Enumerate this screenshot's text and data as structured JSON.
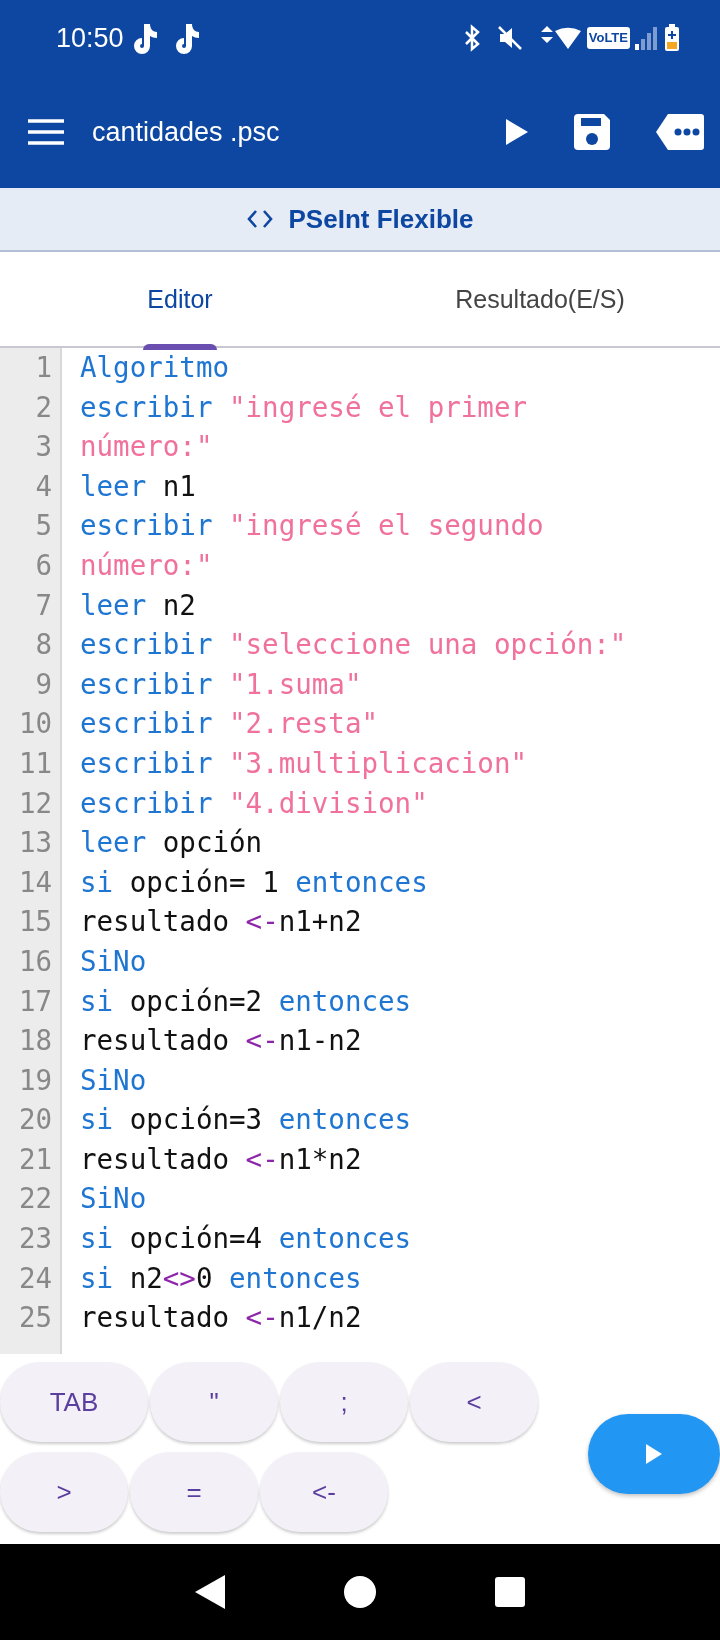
{
  "status_bar": {
    "time": "10:50",
    "volte": "VoLTE"
  },
  "toolbar": {
    "title": "cantidades .psc"
  },
  "mode_bar": {
    "label": "PSeInt Flexible"
  },
  "tabs": [
    {
      "label": "Editor",
      "selected": true
    },
    {
      "label": "Resultado(E/S)",
      "selected": false
    }
  ],
  "editor": {
    "lines": [
      {
        "number": "1",
        "tokens": [
          {
            "kind": "keyword",
            "text": "Algoritmo"
          }
        ]
      },
      {
        "number": "2",
        "tokens": [
          {
            "kind": "keyword",
            "text": "escribir"
          },
          {
            "kind": "string",
            "text": " \"ingresé el primer"
          }
        ]
      },
      {
        "number": "3",
        "tokens": [
          {
            "kind": "string",
            "text": "número:\""
          }
        ]
      },
      {
        "number": "4",
        "tokens": [
          {
            "kind": "keyword",
            "text": "leer"
          },
          {
            "kind": "plain",
            "text": " n1"
          }
        ]
      },
      {
        "number": "5",
        "tokens": [
          {
            "kind": "keyword",
            "text": "escribir"
          },
          {
            "kind": "string",
            "text": " \"ingresé el segundo"
          }
        ]
      },
      {
        "number": "6",
        "tokens": [
          {
            "kind": "string",
            "text": "número:\""
          }
        ]
      },
      {
        "number": "7",
        "tokens": [
          {
            "kind": "keyword",
            "text": "leer"
          },
          {
            "kind": "plain",
            "text": " n2"
          }
        ]
      },
      {
        "number": "8",
        "tokens": [
          {
            "kind": "keyword",
            "text": "escribir"
          },
          {
            "kind": "string",
            "text": " \"seleccione una opción:\""
          }
        ]
      },
      {
        "number": "9",
        "tokens": [
          {
            "kind": "keyword",
            "text": "escribir"
          },
          {
            "kind": "string",
            "text": " \"1.suma\""
          }
        ]
      },
      {
        "number": "10",
        "tokens": [
          {
            "kind": "keyword",
            "text": "escribir"
          },
          {
            "kind": "string",
            "text": " \"2.resta\""
          }
        ]
      },
      {
        "number": "11",
        "tokens": [
          {
            "kind": "keyword",
            "text": "escribir"
          },
          {
            "kind": "string",
            "text": " \"3.multiplicacion\""
          }
        ]
      },
      {
        "number": "12",
        "tokens": [
          {
            "kind": "keyword",
            "text": "escribir"
          },
          {
            "kind": "string",
            "text": " \"4.division\""
          }
        ]
      },
      {
        "number": "13",
        "tokens": [
          {
            "kind": "keyword",
            "text": "leer"
          },
          {
            "kind": "plain",
            "text": " opción"
          }
        ]
      },
      {
        "number": "14",
        "tokens": [
          {
            "kind": "keyword",
            "text": "si"
          },
          {
            "kind": "plain",
            "text": " opción= 1 "
          },
          {
            "kind": "keyword",
            "text": "entonces"
          }
        ]
      },
      {
        "number": "15",
        "tokens": [
          {
            "kind": "plain",
            "text": "resultado "
          },
          {
            "kind": "operator",
            "text": "<-"
          },
          {
            "kind": "plain",
            "text": "n1+n2"
          }
        ]
      },
      {
        "number": "16",
        "tokens": [
          {
            "kind": "keyword",
            "text": "SiNo"
          }
        ]
      },
      {
        "number": "17",
        "tokens": [
          {
            "kind": "keyword",
            "text": "si"
          },
          {
            "kind": "plain",
            "text": " opción=2 "
          },
          {
            "kind": "keyword",
            "text": "entonces"
          }
        ]
      },
      {
        "number": "18",
        "tokens": [
          {
            "kind": "plain",
            "text": "resultado "
          },
          {
            "kind": "operator",
            "text": "<-"
          },
          {
            "kind": "plain",
            "text": "n1-n2"
          }
        ]
      },
      {
        "number": "19",
        "tokens": [
          {
            "kind": "keyword",
            "text": "SiNo"
          }
        ]
      },
      {
        "number": "20",
        "tokens": [
          {
            "kind": "keyword",
            "text": "si"
          },
          {
            "kind": "plain",
            "text": " opción=3 "
          },
          {
            "kind": "keyword",
            "text": "entonces"
          }
        ]
      },
      {
        "number": "21",
        "tokens": [
          {
            "kind": "plain",
            "text": "resultado "
          },
          {
            "kind": "operator",
            "text": "<-"
          },
          {
            "kind": "plain",
            "text": "n1*n2"
          }
        ]
      },
      {
        "number": "22",
        "tokens": [
          {
            "kind": "keyword",
            "text": "SiNo"
          }
        ]
      },
      {
        "number": "23",
        "tokens": [
          {
            "kind": "keyword",
            "text": "si"
          },
          {
            "kind": "plain",
            "text": " opción=4 "
          },
          {
            "kind": "keyword",
            "text": "entonces"
          }
        ]
      },
      {
        "number": "24",
        "tokens": [
          {
            "kind": "keyword",
            "text": "si"
          },
          {
            "kind": "plain",
            "text": " n2"
          },
          {
            "kind": "operator",
            "text": "<>"
          },
          {
            "kind": "plain",
            "text": "0 "
          },
          {
            "kind": "keyword",
            "text": "entonces"
          }
        ]
      },
      {
        "number": "25",
        "tokens": [
          {
            "kind": "plain",
            "text": "resultado "
          },
          {
            "kind": "operator",
            "text": "<-"
          },
          {
            "kind": "plain",
            "text": "n1/n2"
          }
        ]
      }
    ]
  },
  "keys": [
    [
      {
        "label": "TAB"
      },
      {
        "label": "\""
      },
      {
        "label": ";"
      },
      {
        "label": "<"
      }
    ],
    [
      {
        "label": ">"
      },
      {
        "label": "="
      },
      {
        "label": "<-"
      }
    ]
  ]
}
